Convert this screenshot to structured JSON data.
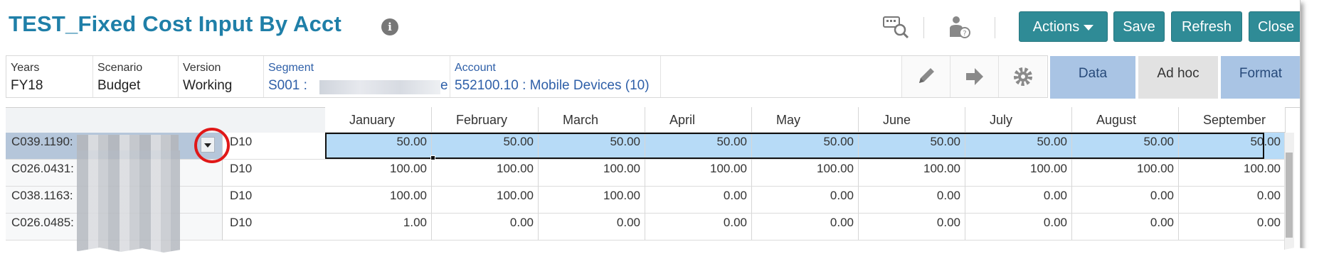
{
  "header": {
    "title": "TEST_Fixed Cost Input By Acct",
    "info_icon": "i"
  },
  "toolbar": {
    "actions_label": "Actions",
    "save_label": "Save",
    "refresh_label": "Refresh",
    "close_label": "Close"
  },
  "pov": {
    "years": {
      "label": "Years",
      "value": "FY18"
    },
    "scenario": {
      "label": "Scenario",
      "value": "Budget"
    },
    "version": {
      "label": "Version",
      "value": "Working"
    },
    "segment": {
      "label": "Segment",
      "value": "S001 :",
      "value_suffix": "e"
    },
    "account": {
      "label": "Account",
      "value": "552100.10 : Mobile Devices (10)"
    }
  },
  "tabs": [
    "Data",
    "Ad hoc",
    "Format"
  ],
  "grid": {
    "columns": [
      "January",
      "February",
      "March",
      "April",
      "May",
      "June",
      "July",
      "August",
      "September"
    ],
    "rows": [
      {
        "code": "C039.1190:",
        "dept": "D10",
        "values": [
          "50.00",
          "50.00",
          "50.00",
          "50.00",
          "50.00",
          "50.00",
          "50.00",
          "50.00",
          "50.00"
        ],
        "selected": true
      },
      {
        "code": "C026.0431:",
        "dept": "D10",
        "values": [
          "100.00",
          "100.00",
          "100.00",
          "100.00",
          "100.00",
          "100.00",
          "100.00",
          "100.00",
          "100.00"
        ]
      },
      {
        "code": "C038.1163:",
        "dept": "D10",
        "values": [
          "100.00",
          "100.00",
          "100.00",
          "0.00",
          "0.00",
          "0.00",
          "0.00",
          "0.00",
          "0.00"
        ]
      },
      {
        "code": "C026.0485:",
        "dept": "D10",
        "values": [
          "1.00",
          "0.00",
          "0.00",
          "0.00",
          "0.00",
          "0.00",
          "0.00",
          "0.00",
          "0.00"
        ]
      }
    ]
  },
  "colors": {
    "title": "#1f7fa8",
    "button": "#2f8b96",
    "selected_row": "#b7dbf7",
    "tab_active": "#a9c4e4",
    "annotation": "#e01818"
  }
}
